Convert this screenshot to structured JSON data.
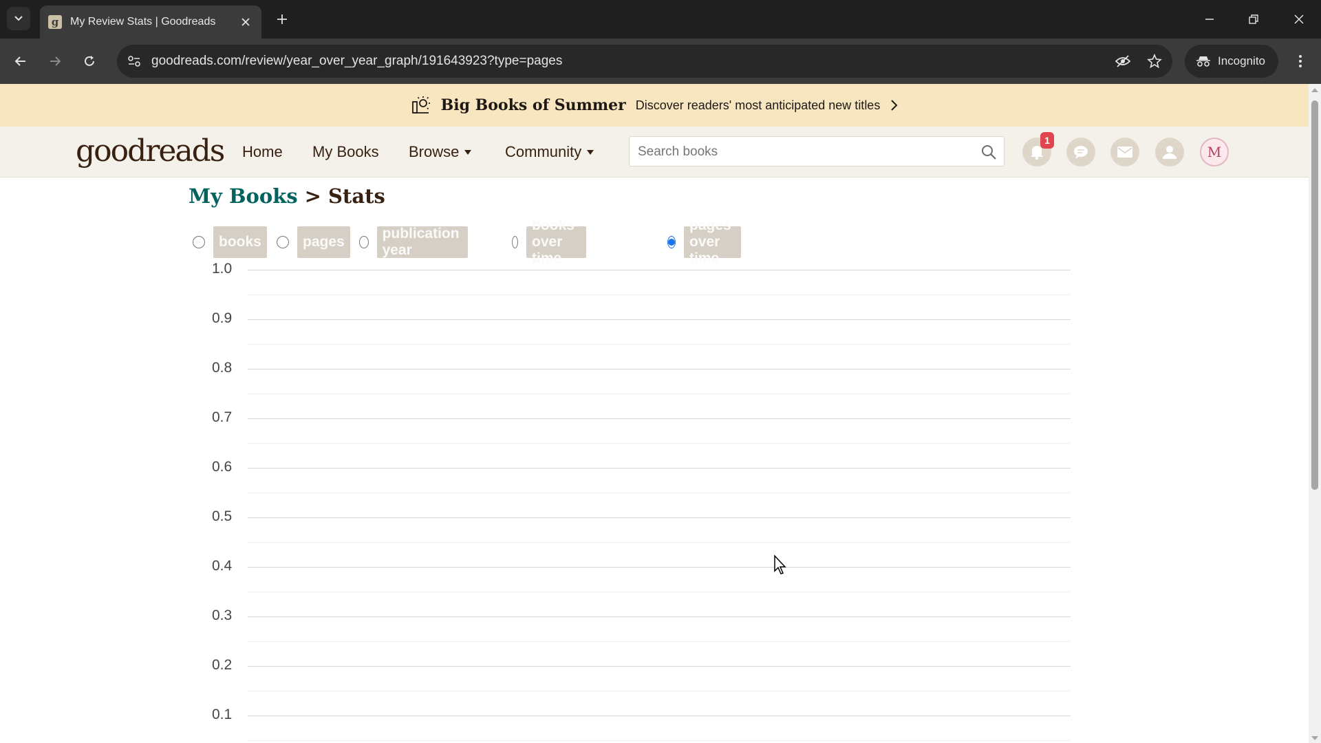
{
  "browser": {
    "tab_title": "My Review Stats | Goodreads",
    "favicon_letter": "g",
    "url": "goodreads.com/review/year_over_year_graph/191643923?type=pages",
    "incognito_label": "Incognito"
  },
  "promo": {
    "title": "Big Books of Summer",
    "text": "Discover readers' most anticipated new titles"
  },
  "header": {
    "logo_light": "good",
    "logo_bold": "reads",
    "nav": [
      "Home",
      "My Books",
      "Browse",
      "Community"
    ],
    "search_placeholder": "Search books",
    "notification_count": "1",
    "avatar_letter": "M"
  },
  "breadcrumb": {
    "parent": "My Books",
    "separator": ">",
    "current": "Stats"
  },
  "stat_options": [
    {
      "label": "books",
      "checked": false
    },
    {
      "label": "pages",
      "checked": false
    },
    {
      "label": "publication year",
      "checked": false
    },
    {
      "label": "books over time",
      "checked": false
    },
    {
      "label": "pages over time",
      "checked": true
    }
  ],
  "chart_data": {
    "type": "line",
    "title": "",
    "xlabel": "",
    "ylabel": "",
    "ylim": [
      0,
      1.0
    ],
    "y_ticks": [
      "1.0",
      "0.9",
      "0.8",
      "0.7",
      "0.6",
      "0.5",
      "0.4",
      "0.3",
      "0.2",
      "0.1"
    ],
    "grid": true,
    "series": []
  }
}
